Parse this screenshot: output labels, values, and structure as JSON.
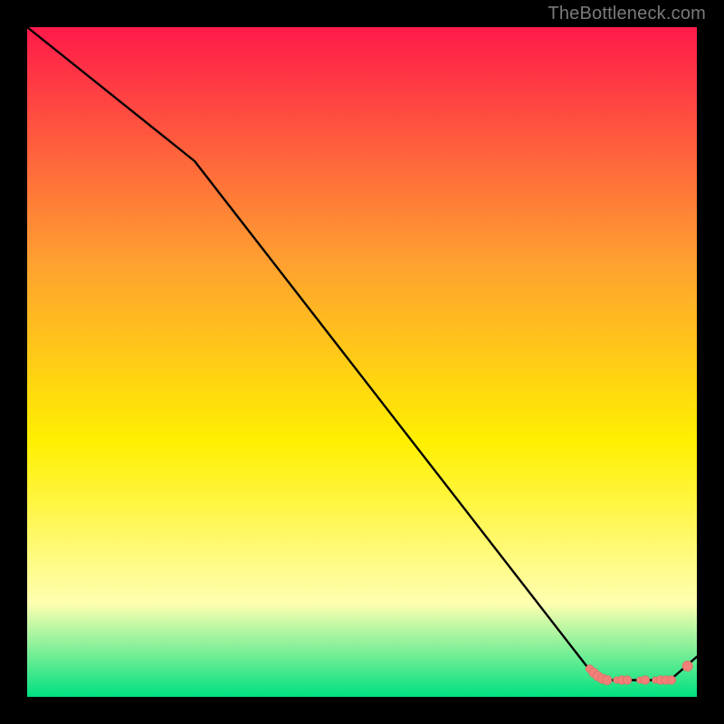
{
  "watermark": "TheBottleneck.com",
  "colors": {
    "background": "#000000",
    "gradient_top": "#ff1a4a",
    "gradient_mid_upper": "#ffa030",
    "gradient_mid": "#fff000",
    "gradient_lower": "#ffffb0",
    "gradient_bottom": "#00e080",
    "line": "#000000",
    "marker_fill": "#f08078",
    "marker_stroke": "#e06a62"
  },
  "chart_data": {
    "type": "line",
    "title": "",
    "xlabel": "",
    "ylabel": "",
    "xlim": [
      0,
      100
    ],
    "ylim": [
      0,
      100
    ],
    "series": [
      {
        "name": "curve",
        "x": [
          0,
          25,
          84,
          86,
          89,
          91.5,
          93,
          96,
          100
        ],
        "y": [
          100,
          80,
          4,
          2.5,
          2.5,
          2.5,
          2.5,
          2.5,
          6
        ]
      }
    ],
    "markers": {
      "name": "cluster",
      "points": [
        {
          "x": 84.0,
          "y": 4.2,
          "r": 2.2
        },
        {
          "x": 84.6,
          "y": 3.6,
          "r": 2.6
        },
        {
          "x": 85.2,
          "y": 3.1,
          "r": 2.6
        },
        {
          "x": 85.9,
          "y": 2.7,
          "r": 2.6
        },
        {
          "x": 86.6,
          "y": 2.5,
          "r": 2.6
        },
        {
          "x": 88.0,
          "y": 2.5,
          "r": 1.8
        },
        {
          "x": 88.8,
          "y": 2.5,
          "r": 2.4
        },
        {
          "x": 89.6,
          "y": 2.5,
          "r": 2.4
        },
        {
          "x": 91.5,
          "y": 2.5,
          "r": 1.8
        },
        {
          "x": 92.3,
          "y": 2.5,
          "r": 2.4
        },
        {
          "x": 93.8,
          "y": 2.5,
          "r": 1.8
        },
        {
          "x": 94.6,
          "y": 2.5,
          "r": 2.4
        },
        {
          "x": 95.4,
          "y": 2.5,
          "r": 2.4
        },
        {
          "x": 96.2,
          "y": 2.5,
          "r": 2.4
        },
        {
          "x": 98.6,
          "y": 4.6,
          "r": 2.8
        }
      ]
    }
  }
}
